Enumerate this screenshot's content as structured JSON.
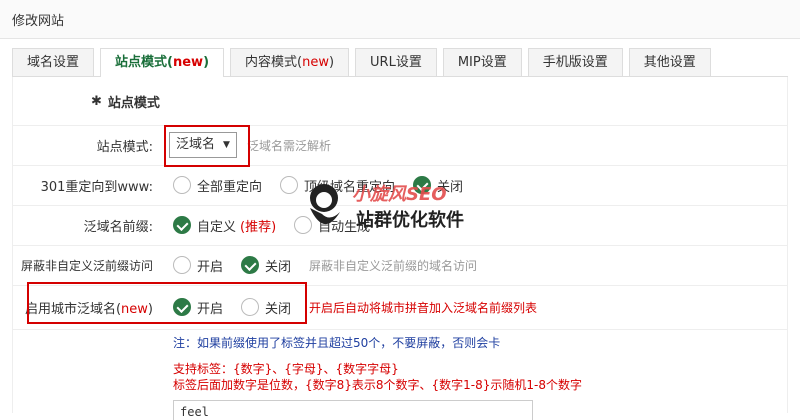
{
  "window": {
    "title": "修改网站"
  },
  "tabs": [
    {
      "label": "域名设置",
      "new": ""
    },
    {
      "label": "站点模式(",
      "new": "new",
      "close": ")"
    },
    {
      "label": "内容模式(",
      "new": "new",
      "close": ")"
    },
    {
      "label": "URL设置",
      "new": ""
    },
    {
      "label": "MIP设置",
      "new": ""
    },
    {
      "label": "手机版设置",
      "new": ""
    },
    {
      "label": "其他设置",
      "new": ""
    }
  ],
  "section": {
    "title": "站点模式"
  },
  "site_mode": {
    "label": "站点模式:",
    "selected": "泛域名",
    "hint": "泛域名需泛解析"
  },
  "redirect301": {
    "label": "301重定向到www:",
    "opt1": "全部重定向",
    "opt2": "顶级域名重定向",
    "opt3": "关闭"
  },
  "prefix": {
    "label": "泛域名前缀:",
    "opt1": "自定义",
    "opt1_note": "(推荐)",
    "opt2": "自动生成"
  },
  "block": {
    "label": "屏蔽非自定义泛前缀访问",
    "opt_on": "开启",
    "opt_off": "关闭",
    "hint": "屏蔽非自定义泛前缀的域名访问"
  },
  "city": {
    "label": "启用城市泛域名(",
    "label_new": "new",
    "label_close": ")",
    "opt_on": "开启",
    "opt_off": "关闭",
    "hint": "开启后自动将城市拼音加入泛域名前缀列表"
  },
  "note": {
    "text": "注：如果前缀使用了标签并且超过50个，不要屏蔽，否则会卡"
  },
  "tags": {
    "line1": "支持标签：{数字}、{字母}、{数字字母}",
    "line2": "标签后面加数字是位数，{数字8}表示8个数字、{数字1-8}示随机1-8个数字"
  },
  "textarea": {
    "value": "feel"
  },
  "watermark": {
    "brand": "小旋风SEO",
    "sub": "站群优化软件"
  }
}
